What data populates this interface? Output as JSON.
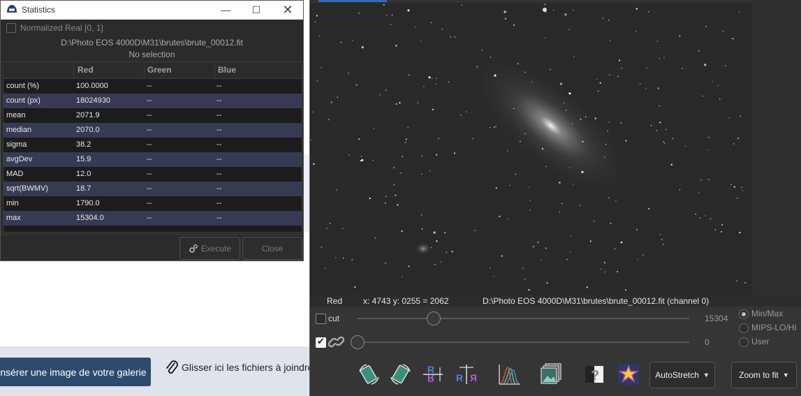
{
  "background_page": {
    "gallery_button": "nsérer une image de votre galerie",
    "drop_text": "Glisser ici les fichiers à joindre"
  },
  "statistics": {
    "title": "Statistics",
    "normalized_label": "Normalized Real [0, 1]",
    "normalized_checked": false,
    "file_path": "D:\\Photo EOS 4000D\\M31\\brutes\\brute_00012.fit",
    "selection_text": "No selection",
    "columns": [
      "",
      "Red",
      "Green",
      "Blue"
    ],
    "rows": [
      {
        "label": "count (%)",
        "red": "100.0000",
        "green": "--",
        "blue": "--"
      },
      {
        "label": "count (px)",
        "red": "18024930",
        "green": "--",
        "blue": "--"
      },
      {
        "label": "mean",
        "red": "2071.9",
        "green": "--",
        "blue": "--"
      },
      {
        "label": "median",
        "red": "2070.0",
        "green": "--",
        "blue": "--"
      },
      {
        "label": "sigma",
        "red": "38.2",
        "green": "--",
        "blue": "--"
      },
      {
        "label": "avgDev",
        "red": "15.9",
        "green": "--",
        "blue": "--"
      },
      {
        "label": "MAD",
        "red": "12.0",
        "green": "--",
        "blue": "--"
      },
      {
        "label": "sqrt(BWMV)",
        "red": "18.7",
        "green": "--",
        "blue": "--"
      },
      {
        "label": "min",
        "red": "1790.0",
        "green": "--",
        "blue": "--"
      },
      {
        "label": "max",
        "red": "15304.0",
        "green": "--",
        "blue": "--"
      }
    ],
    "execute_label": "Execute",
    "close_label": "Close"
  },
  "viewer": {
    "channel": "Red",
    "coords": "x: 4743 y: 0255 = 2062",
    "file_info": "D:\\Photo EOS 4000D\\M31\\brutes\\brute_00012.fit (channel 0)",
    "cut_label": "cut",
    "cut_checked": false,
    "hi_value": "15304",
    "lo_value": "0",
    "link_checked": true,
    "hi_slider_fraction": 0.23,
    "lo_slider_fraction": 0.0,
    "scale_modes": [
      {
        "label": "Min/Max",
        "selected": true
      },
      {
        "label": "MIPS-LO/HI",
        "selected": false
      },
      {
        "label": "User",
        "selected": false
      }
    ],
    "stretch_mode": "AutoStretch",
    "zoom_mode": "Zoom to fit",
    "toolbar_icons": [
      "rotate-left-icon",
      "rotate-right-icon",
      "mirror-x-icon",
      "mirror-y-icon",
      "histogram-icon",
      "image-stack-icon",
      "negative-view-icon",
      "color-map-icon"
    ]
  },
  "colors": {
    "accent": "#2e6dbf",
    "table_alt_row": "#363a52",
    "gallery_button": "#2d4b6e"
  }
}
